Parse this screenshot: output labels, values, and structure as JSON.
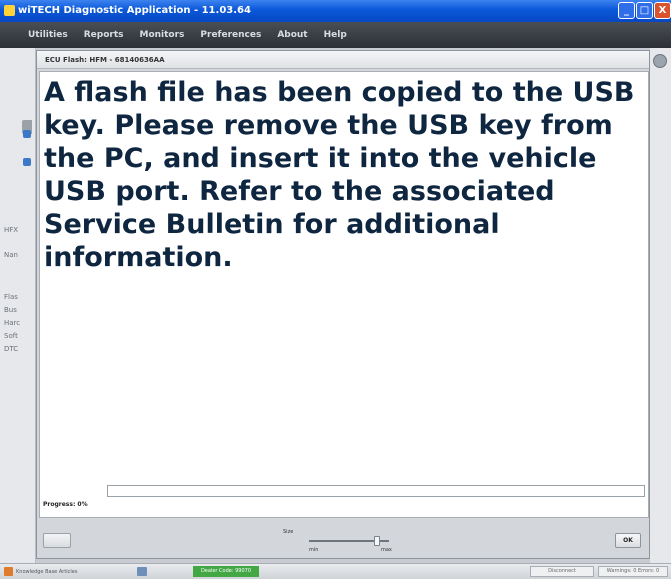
{
  "window": {
    "title": "wiTECH Diagnostic Application - 11.03.64",
    "min_glyph": "_",
    "max_glyph": "□",
    "close_glyph": "X"
  },
  "menu": {
    "items": [
      "Utilities",
      "Reports",
      "Monitors",
      "Preferences",
      "About",
      "Help"
    ]
  },
  "background": {
    "fragments": [
      "HFX",
      "Nan",
      "Flas",
      "Bus",
      "Harc",
      "Soft",
      "DTC"
    ]
  },
  "dialog": {
    "title": "ECU Flash: HFM - 68140636AA",
    "message": "A flash file has been copied to the USB key. Please remove the USB key from the PC, and insert it into the vehicle USB port. Refer to the associated Service Bulletin for additional information.",
    "progress_label": "Progress: 0%",
    "progress_value": 0,
    "size_label": "Size",
    "size_min": "min",
    "size_max": "max",
    "size_value": 0.85,
    "ok_label": "OK"
  },
  "statusbar": {
    "knowledge_base": "Knowledge Base Articles",
    "dealer_code": "Dealer Code: 99070",
    "disconnect": "Disconnect",
    "warnings": "Warnings: 0 Errors: 0"
  },
  "colors": {
    "titlebar": "#0a58d8",
    "menubar": "#2c3035",
    "message_text": "#0f2640",
    "dealer_badge": "#43a844"
  }
}
